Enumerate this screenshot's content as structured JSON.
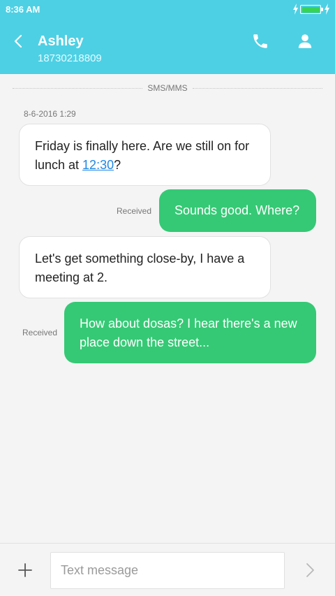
{
  "status_bar": {
    "time": "8:36 AM",
    "battery_color": "#39d353"
  },
  "header": {
    "name": "Ashley",
    "number": "18730218809",
    "background_color": "#4dd0e4",
    "back_icon": "chevron-left-icon",
    "call_icon": "phone-icon",
    "profile_icon": "person-icon"
  },
  "conversation": {
    "channel_label": "SMS/MMS",
    "timestamp": "8-6-2016 1:29",
    "messages": [
      {
        "direction": "incoming",
        "text_before_link": "Friday is finally here. Are we still on for lunch at ",
        "link_text": "12:30",
        "text_after_link": "?"
      },
      {
        "direction": "outgoing",
        "status": "Received",
        "text": "Sounds good. Where?"
      },
      {
        "direction": "incoming",
        "text": "Let's get something close-by, I have a meeting at 2."
      },
      {
        "direction": "outgoing",
        "status": "Received",
        "text": "How about dosas? I hear there's a new place down the street..."
      }
    ],
    "incoming_bubble_color": "#ffffff",
    "outgoing_bubble_color": "#35c975"
  },
  "composer": {
    "placeholder": "Text message",
    "value": "",
    "add_icon": "plus-icon",
    "send_icon": "chevron-right-icon"
  }
}
